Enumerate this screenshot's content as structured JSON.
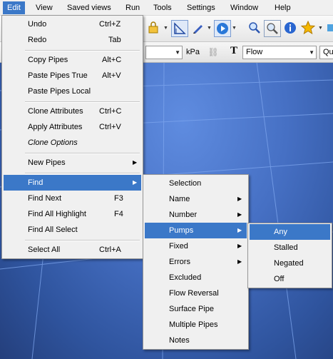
{
  "menubar": {
    "items": [
      "Edit",
      "View",
      "Saved views",
      "Run",
      "Tools",
      "Settings",
      "Window",
      "Help"
    ]
  },
  "toolbar": {
    "unit_label": "kPa",
    "text_tool_glyph": "T",
    "flow_combo_value": "Flow",
    "quality_combo_value": "Qua"
  },
  "edit_menu": {
    "items": [
      {
        "label": "Undo",
        "shortcut": "Ctrl+Z"
      },
      {
        "label": "Redo",
        "shortcut": "Tab"
      },
      {
        "label": "Copy Pipes",
        "shortcut": "Alt+C"
      },
      {
        "label": "Paste Pipes True",
        "shortcut": "Alt+V"
      },
      {
        "label": "Paste Pipes Local",
        "shortcut": ""
      },
      {
        "label": "Clone Attributes",
        "shortcut": "Ctrl+C"
      },
      {
        "label": "Apply Attributes",
        "shortcut": "Ctrl+V"
      },
      {
        "label": "Clone Options",
        "shortcut": ""
      },
      {
        "label": "New Pipes",
        "shortcut": ""
      },
      {
        "label": "Find",
        "shortcut": ""
      },
      {
        "label": "Find Next",
        "shortcut": "F3"
      },
      {
        "label": "Find All Highlight",
        "shortcut": "F4"
      },
      {
        "label": "Find All Select",
        "shortcut": ""
      },
      {
        "label": "Select All",
        "shortcut": "Ctrl+A"
      }
    ]
  },
  "find_menu": {
    "items": [
      "Selection",
      "Name",
      "Number",
      "Pumps",
      "Fixed",
      "Errors",
      "Excluded",
      "Flow Reversal",
      "Surface Pipe",
      "Multiple Pipes",
      "Notes"
    ]
  },
  "pumps_menu": {
    "items": [
      "Any",
      "Stalled",
      "Negated",
      "Off"
    ]
  },
  "colors": {
    "highlight": "#3b78c8",
    "menu_bg": "#f0f0f0",
    "viewport_bg": "#4670c4"
  }
}
